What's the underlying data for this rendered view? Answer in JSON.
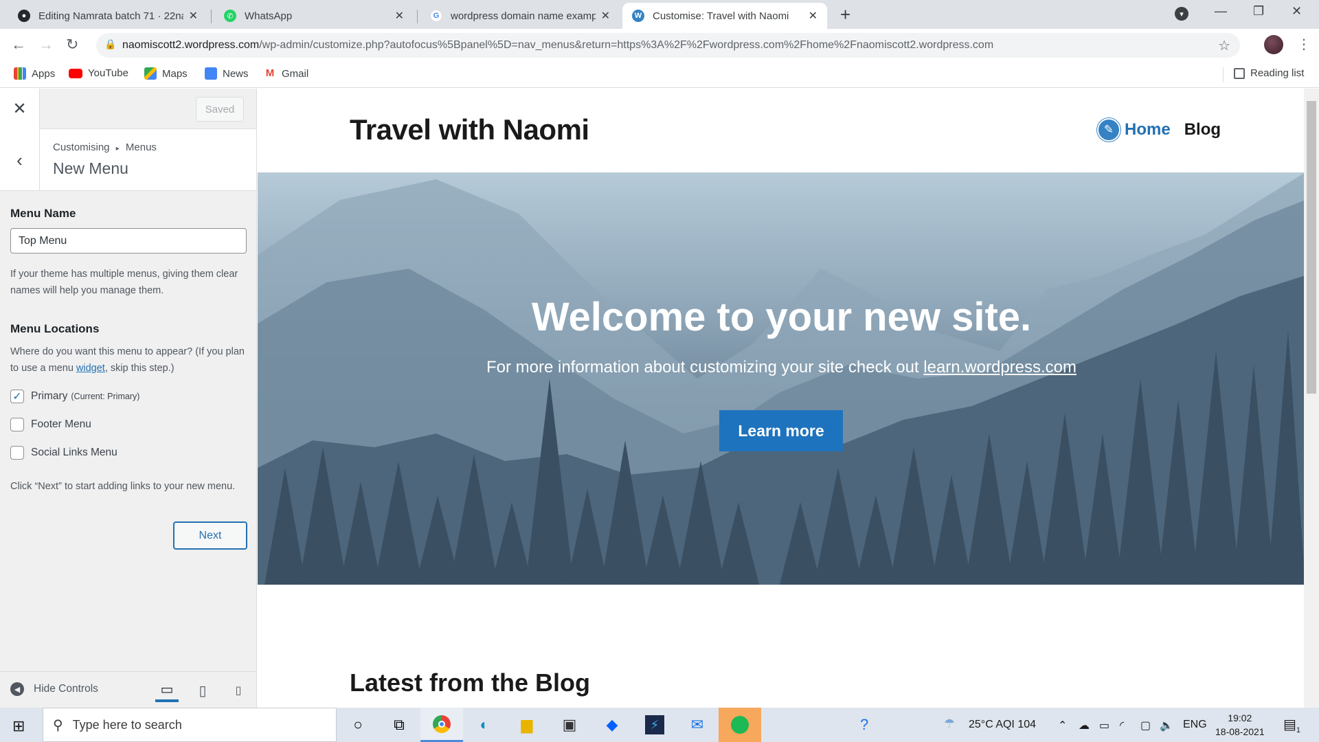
{
  "browser": {
    "tabs": [
      {
        "title": "Editing Namrata batch 71 · 22nar",
        "icon": "github-icon",
        "active": false
      },
      {
        "title": "WhatsApp",
        "icon": "whatsapp-icon",
        "active": false
      },
      {
        "title": "wordpress domain name exampl",
        "icon": "google-icon",
        "active": false
      },
      {
        "title": "Customise: Travel with Naomi",
        "icon": "wordpress-icon",
        "active": true
      }
    ],
    "url_host": "naomiscott2.wordpress.com",
    "url_path": "/wp-admin/customize.php?autofocus%5Bpanel%5D=nav_menus&return=https%3A%2F%2Fwordpress.com%2Fhome%2Fnaomiscott2.wordpress.com",
    "bookmarks": [
      "Apps",
      "YouTube",
      "Maps",
      "News",
      "Gmail"
    ],
    "reading_list": "Reading list"
  },
  "customizer": {
    "saved_label": "Saved",
    "breadcrumb_root": "Customising",
    "breadcrumb_sep": "▸",
    "breadcrumb_panel": "Menus",
    "section_title": "New Menu",
    "menu_name_label": "Menu Name",
    "menu_name_value": "Top Menu",
    "menu_name_help": "If your theme has multiple menus, giving them clear names will help you manage them.",
    "locations_label": "Menu Locations",
    "locations_help_pre": "Where do you want this menu to appear? (If you plan to use a menu ",
    "locations_help_link": "widget",
    "locations_help_post": ", skip this step.)",
    "locations": [
      {
        "label": "Primary",
        "note": "(Current: Primary)",
        "checked": true
      },
      {
        "label": "Footer Menu",
        "note": "",
        "checked": false
      },
      {
        "label": "Social Links Menu",
        "note": "",
        "checked": false
      }
    ],
    "next_help": "Click “Next” to start adding links to your new menu.",
    "next_label": "Next",
    "hide_controls": "Hide Controls"
  },
  "site": {
    "title": "Travel with Naomi",
    "nav_home": "Home",
    "nav_blog": "Blog",
    "hero_title": "Welcome to your new site.",
    "hero_sub_pre": "For more information about customizing your site check out ",
    "hero_sub_link": "learn.wordpress.com",
    "hero_button": "Learn more",
    "blog_heading": "Latest from the Blog"
  },
  "taskbar": {
    "search_placeholder": "Type here to search",
    "weather": "25°C  AQI 104",
    "lang": "ENG",
    "time": "19:02",
    "date": "18-08-2021",
    "notifications": "1"
  },
  "colors": {
    "wp_blue": "#2271b1",
    "hero_button": "#1e73be"
  }
}
